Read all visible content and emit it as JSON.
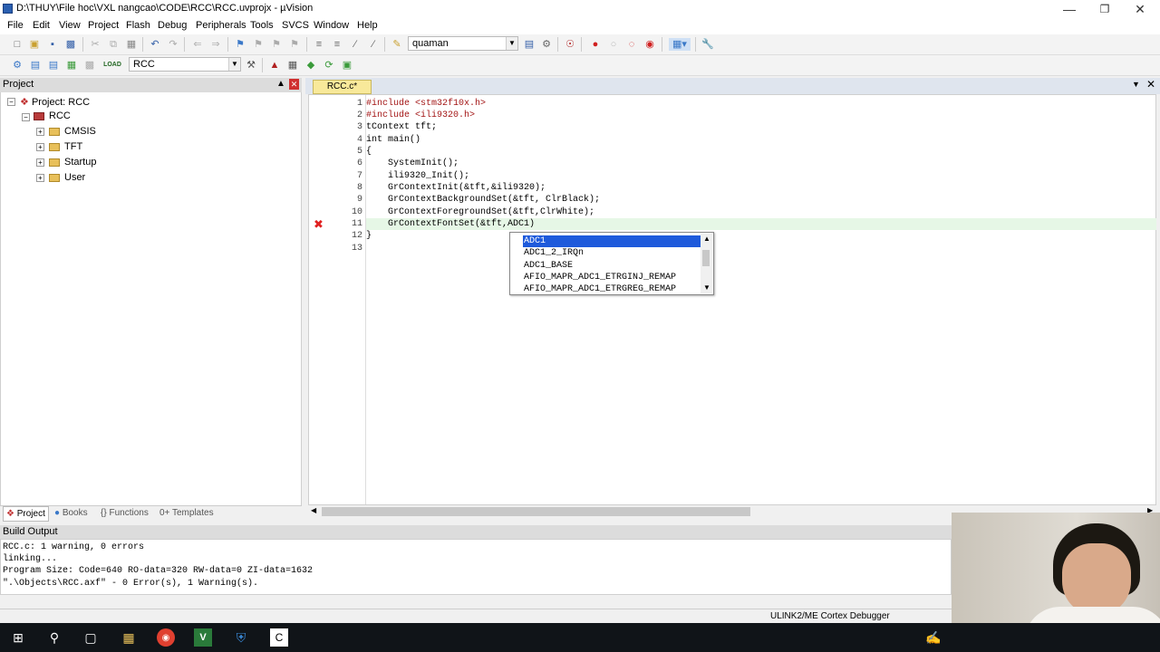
{
  "window": {
    "title": "D:\\THUY\\File hoc\\VXL nangcao\\CODE\\RCC\\RCC.uvprojx - µVision"
  },
  "menu": [
    "File",
    "Edit",
    "View",
    "Project",
    "Flash",
    "Debug",
    "Peripherals",
    "Tools",
    "SVCS",
    "Window",
    "Help"
  ],
  "toolbar": {
    "find_combo": "quaman",
    "target_combo": "RCC",
    "load_label": "LOAD"
  },
  "project": {
    "header": "Project",
    "root": "Project: RCC",
    "target": "RCC",
    "groups": [
      "CMSIS",
      "TFT",
      "Startup",
      "User"
    ],
    "tabs": [
      "Project",
      "Books",
      "{} Functions",
      "0+ Templates"
    ]
  },
  "editor": {
    "tab": "RCC.c*",
    "line_numbers": [
      "1",
      "2",
      "3",
      "4",
      "5",
      "6",
      "7",
      "8",
      "9",
      "10",
      "11",
      "12",
      "13"
    ],
    "lines": [
      "#include <stm32f10x.h>",
      "#include <ili9320.h>",
      "tContext tft;",
      "int main()",
      "{",
      "    SystemInit();",
      "    ili9320_Init();",
      "    GrContextInit(&tft,&ili9320);",
      "    GrContextBackgroundSet(&tft, ClrBlack);",
      "    GrContextForegroundSet(&tft,ClrWhite);",
      "    GrContextFontSet(&tft,ADC1)",
      "}",
      ""
    ],
    "error_line": "11"
  },
  "autocomplete": [
    "ADC1",
    "ADC1_2_IRQn",
    "ADC1_BASE",
    "AFIO_MAPR_ADC1_ETRGINJ_REMAP",
    "AFIO_MAPR_ADC1_ETRGREG_REMAP"
  ],
  "build": {
    "header": "Build Output",
    "lines": [
      "RCC.c: 1 warning, 0 errors",
      "linking...",
      "Program Size: Code=640 RO-data=320 RW-data=0 ZI-data=1632",
      "\".\\Objects\\RCC.axf\" - 0 Error(s), 1 Warning(s)."
    ]
  },
  "status": {
    "debugger": "ULINK2/ME Cortex Debugger"
  },
  "colors": {
    "selection": "#1e5adb",
    "tab_active": "#f8e99a",
    "keyword": "#0000ff",
    "string": "#a31515"
  }
}
